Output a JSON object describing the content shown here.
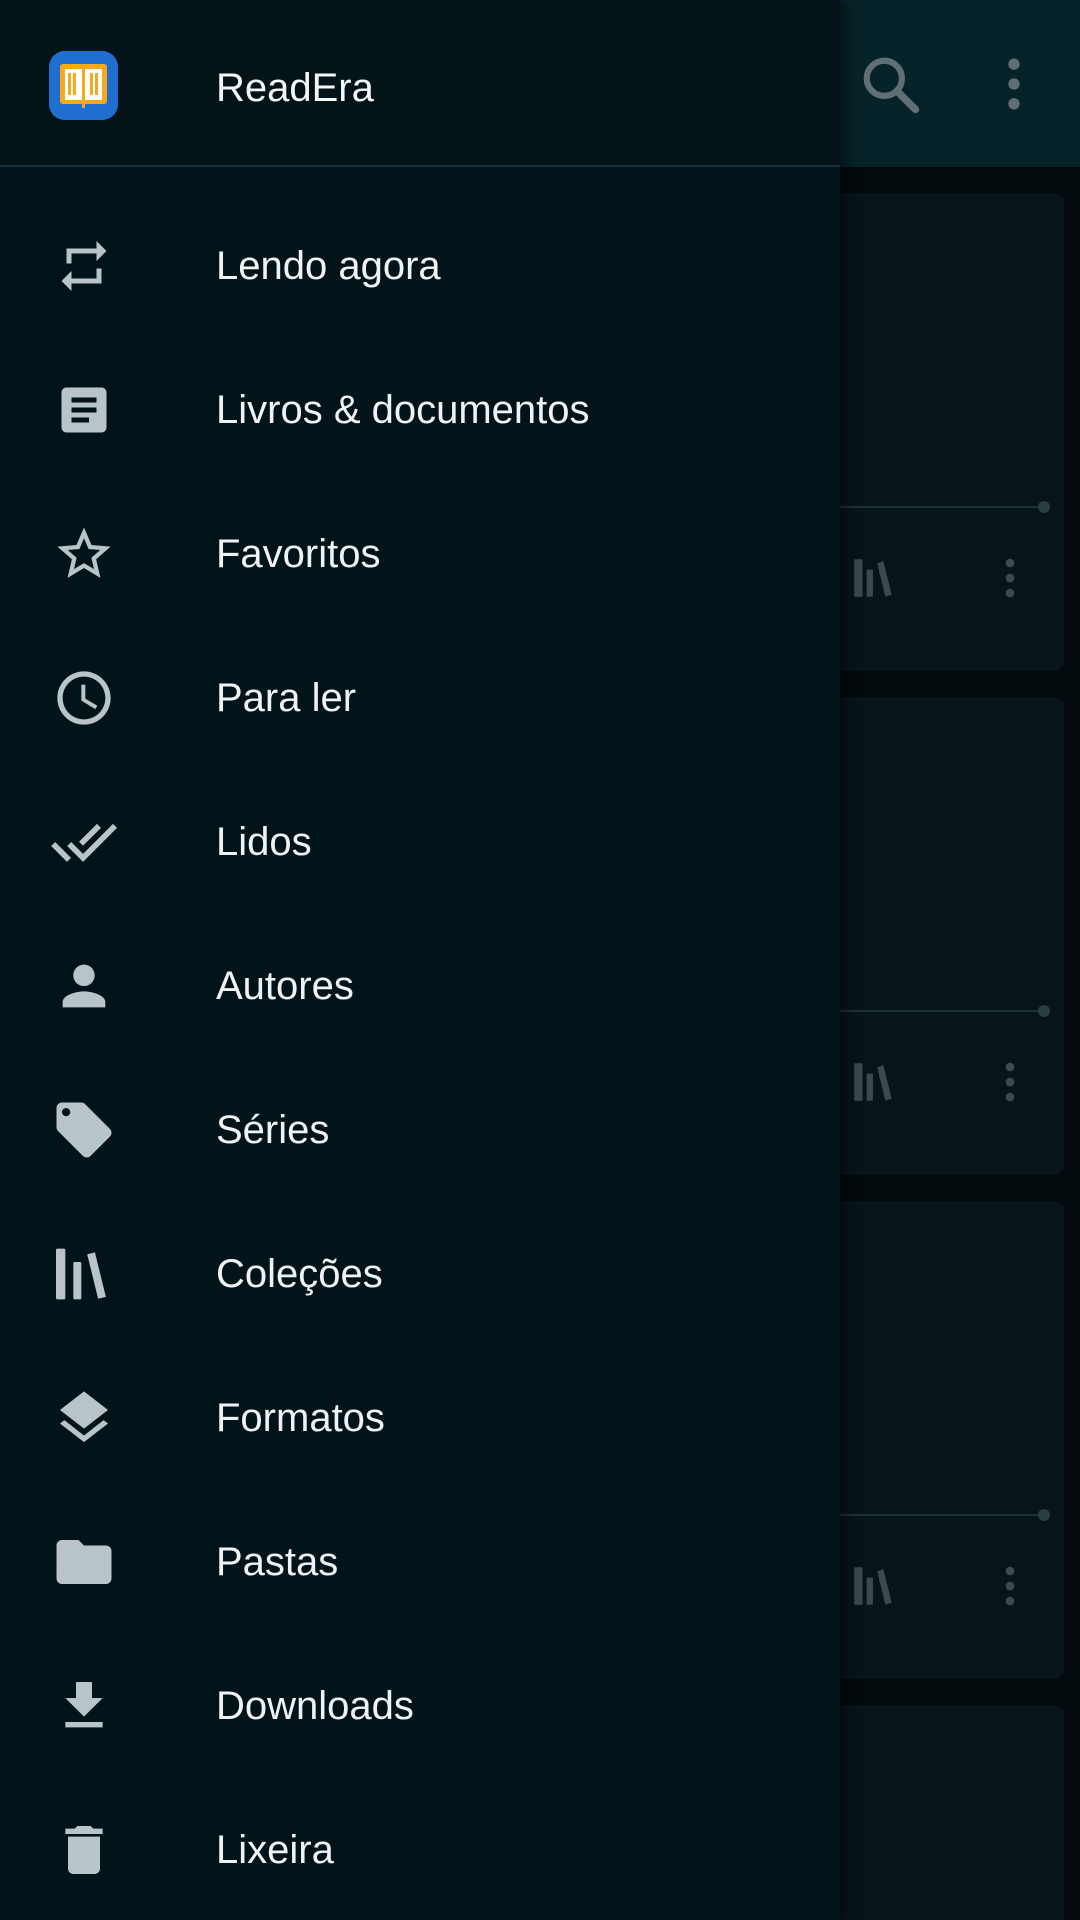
{
  "drawer": {
    "app_title": "ReadEra",
    "items": [
      {
        "label": "Lendo agora",
        "icon": "repeat-icon"
      },
      {
        "label": "Livros & documentos",
        "icon": "document-icon"
      },
      {
        "label": "Favoritos",
        "icon": "star-icon"
      },
      {
        "label": "Para ler",
        "icon": "clock-icon"
      },
      {
        "label": "Lidos",
        "icon": "double-check-icon"
      },
      {
        "label": "Autores",
        "icon": "person-icon"
      },
      {
        "label": "Séries",
        "icon": "tag-icon"
      },
      {
        "label": "Coleções",
        "icon": "shelf-icon"
      },
      {
        "label": "Formatos",
        "icon": "layers-icon"
      },
      {
        "label": "Pastas",
        "icon": "folder-icon"
      },
      {
        "label": "Downloads",
        "icon": "download-icon"
      },
      {
        "label": "Lixeira",
        "icon": "trash-icon"
      }
    ]
  },
  "toolbar": {
    "search_icon": "search-icon",
    "menu_icon": "more-vert-icon"
  },
  "colors": {
    "drawer_bg": "#021419",
    "toolbar_bg": "#07232a",
    "icon": "#b8c4c7",
    "text": "#f0f3f4",
    "logo_bg": "#1f6fd0",
    "logo_book": "#f7a81b"
  }
}
